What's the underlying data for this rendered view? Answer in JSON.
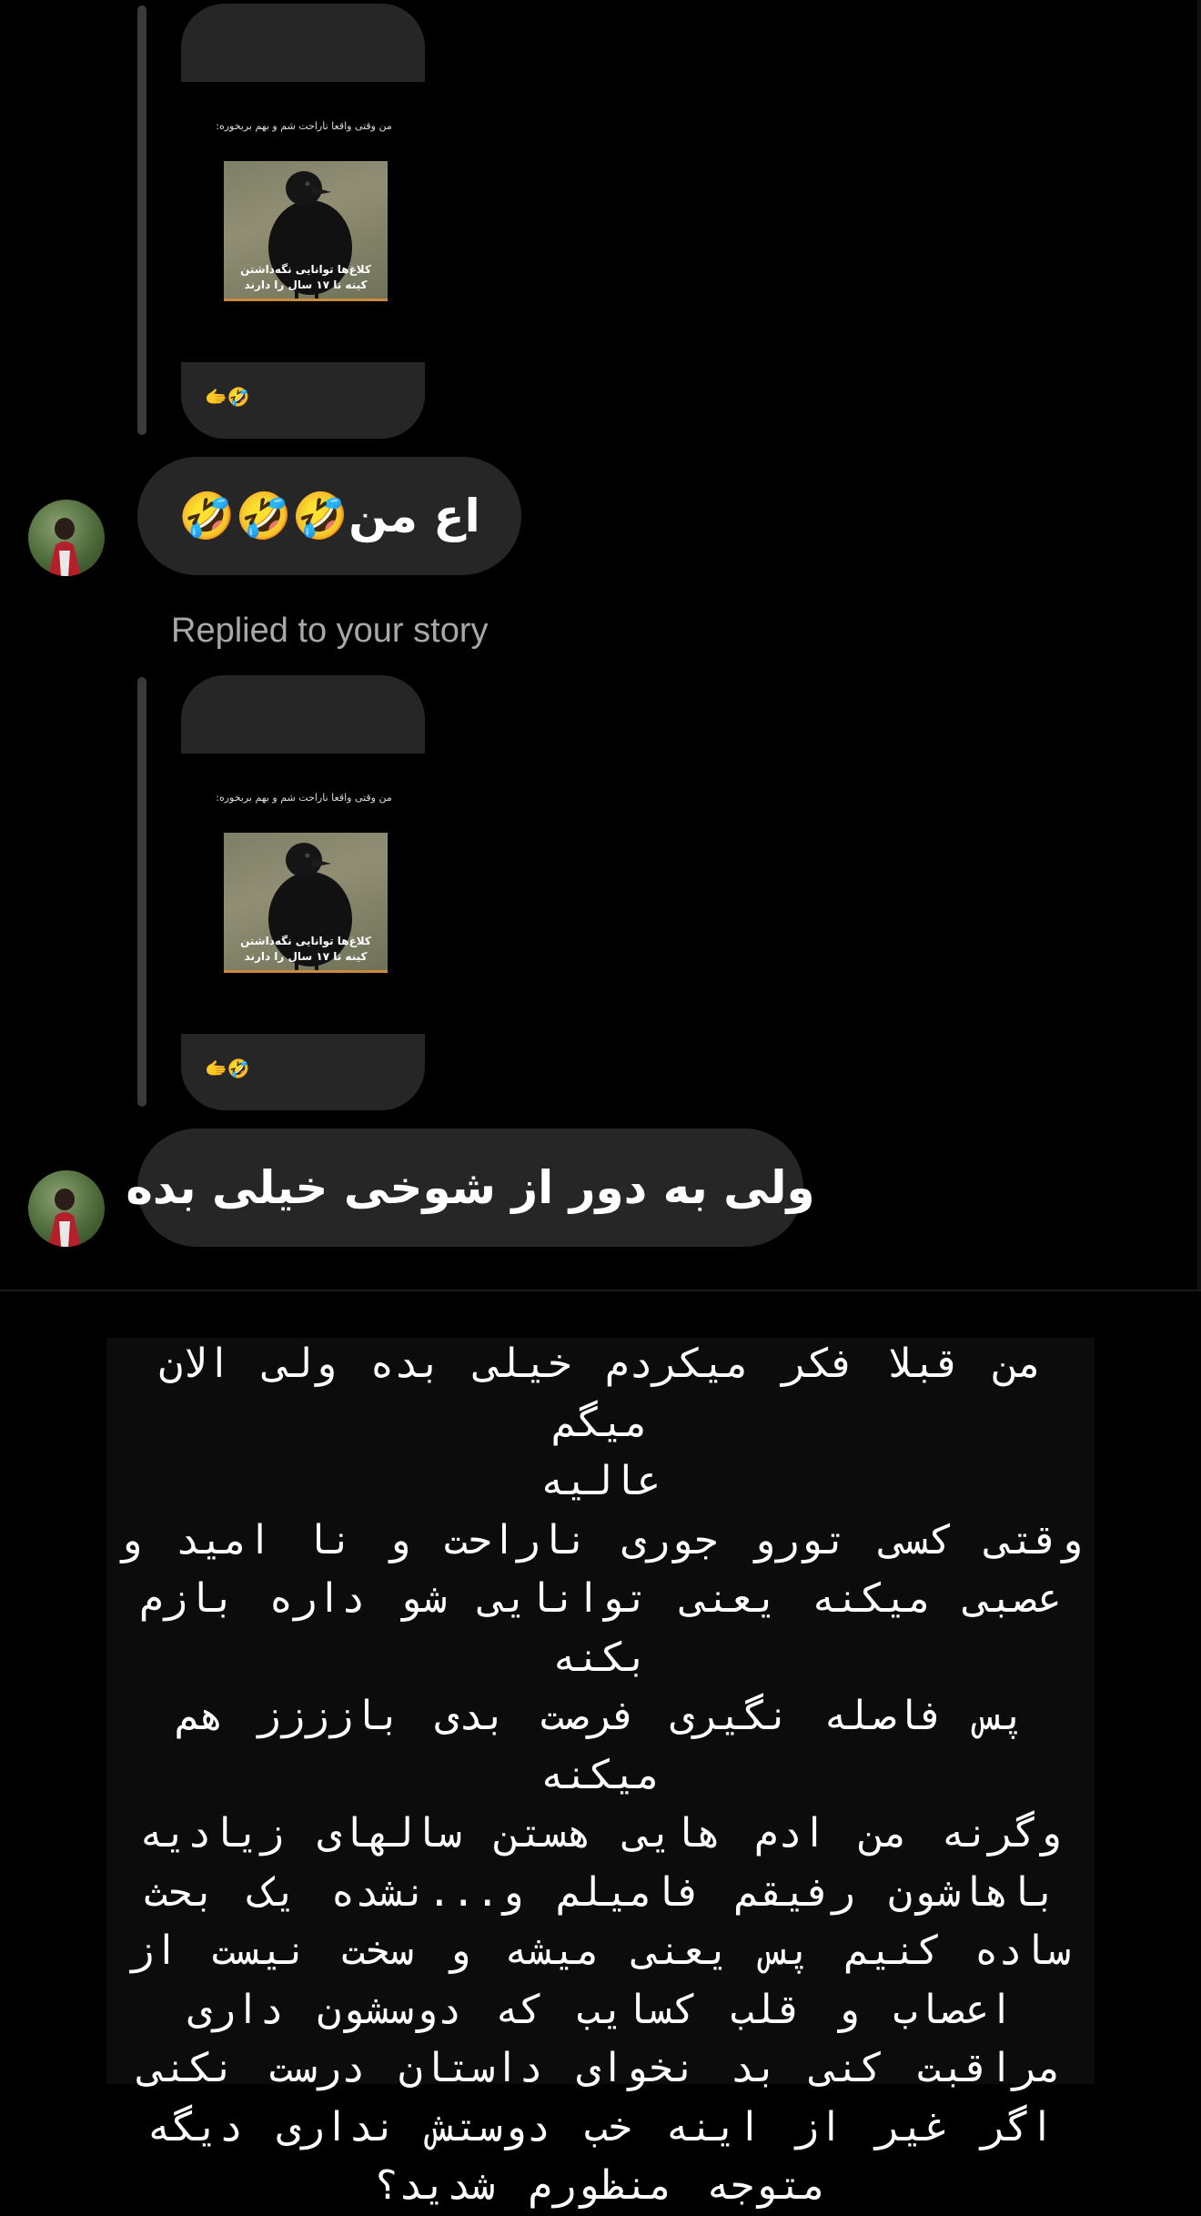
{
  "stories": [
    {
      "caption": "من وقتی واقعا ناراحت شم و بهم بربخوره:",
      "photo_text_line1": "کلاغ‌ها توانایی نگه‌داشتن",
      "photo_text_line2": "کینه تا ۱۷ سال را دارند",
      "reaction": "🫱🤣"
    },
    {
      "caption": "من وقتی واقعا ناراحت شم و بهم بربخوره:",
      "photo_text_line1": "کلاغ‌ها توانایی نگه‌داشتن",
      "photo_text_line2": "کینه تا ۱۷ سال را دارند",
      "reaction": "🫱🤣"
    }
  ],
  "messages": [
    {
      "text": "اع من🤣🤣🤣"
    },
    {
      "text": "ولی به دور از شوخی خیلی بده"
    }
  ],
  "replied_label": "Replied to your story",
  "note_lines": [
    "من قبلا فکر میکردم خیلی بده ولی الان میگم",
    "عالیه",
    "وقتی کسی تورو جوری ناراحت و نا امید و",
    "عصبی میکنه یعنی توانایی شو داره بازم بکنه",
    "پس فاصله نگیری فرصت بدی بازززز هم میکنه",
    "وگرنه من ادم هایی هستن سالهای زیادیه",
    "باهاشون رفیقم فامیلم و...نشده یک بحث",
    "ساده کنیم پس یعنی میشه و سخت نیست از",
    "اعصاب و قلب کسایب که دوسشون داری",
    "مراقبت کنی بد نخوای داستان درست نکنی",
    "اگر غیر از اینه خب دوستش نداری دیگه",
    "متوجه منظورم شدید؟"
  ]
}
